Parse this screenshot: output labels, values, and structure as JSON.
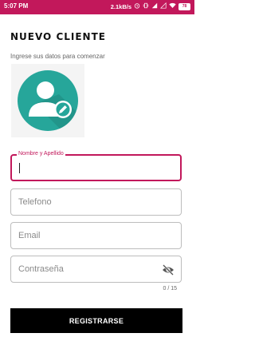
{
  "status_bar": {
    "time": "5:07 PM",
    "network_speed": "2.1kB/s",
    "battery": "78"
  },
  "header": {
    "title": "NUEVO CLIENTE",
    "subtitle": "Ingrese sus datos para comenzar"
  },
  "form": {
    "name_label": "Nombre y Apellido",
    "name_value": "",
    "phone_placeholder": "Telefono",
    "email_placeholder": "Email",
    "password_placeholder": "Contraseña",
    "password_counter": "0 / 15"
  },
  "actions": {
    "register_label": "REGISTRARSE"
  },
  "colors": {
    "accent": "#c2185b",
    "avatar_bg": "#26a69a",
    "button_bg": "#000000"
  }
}
